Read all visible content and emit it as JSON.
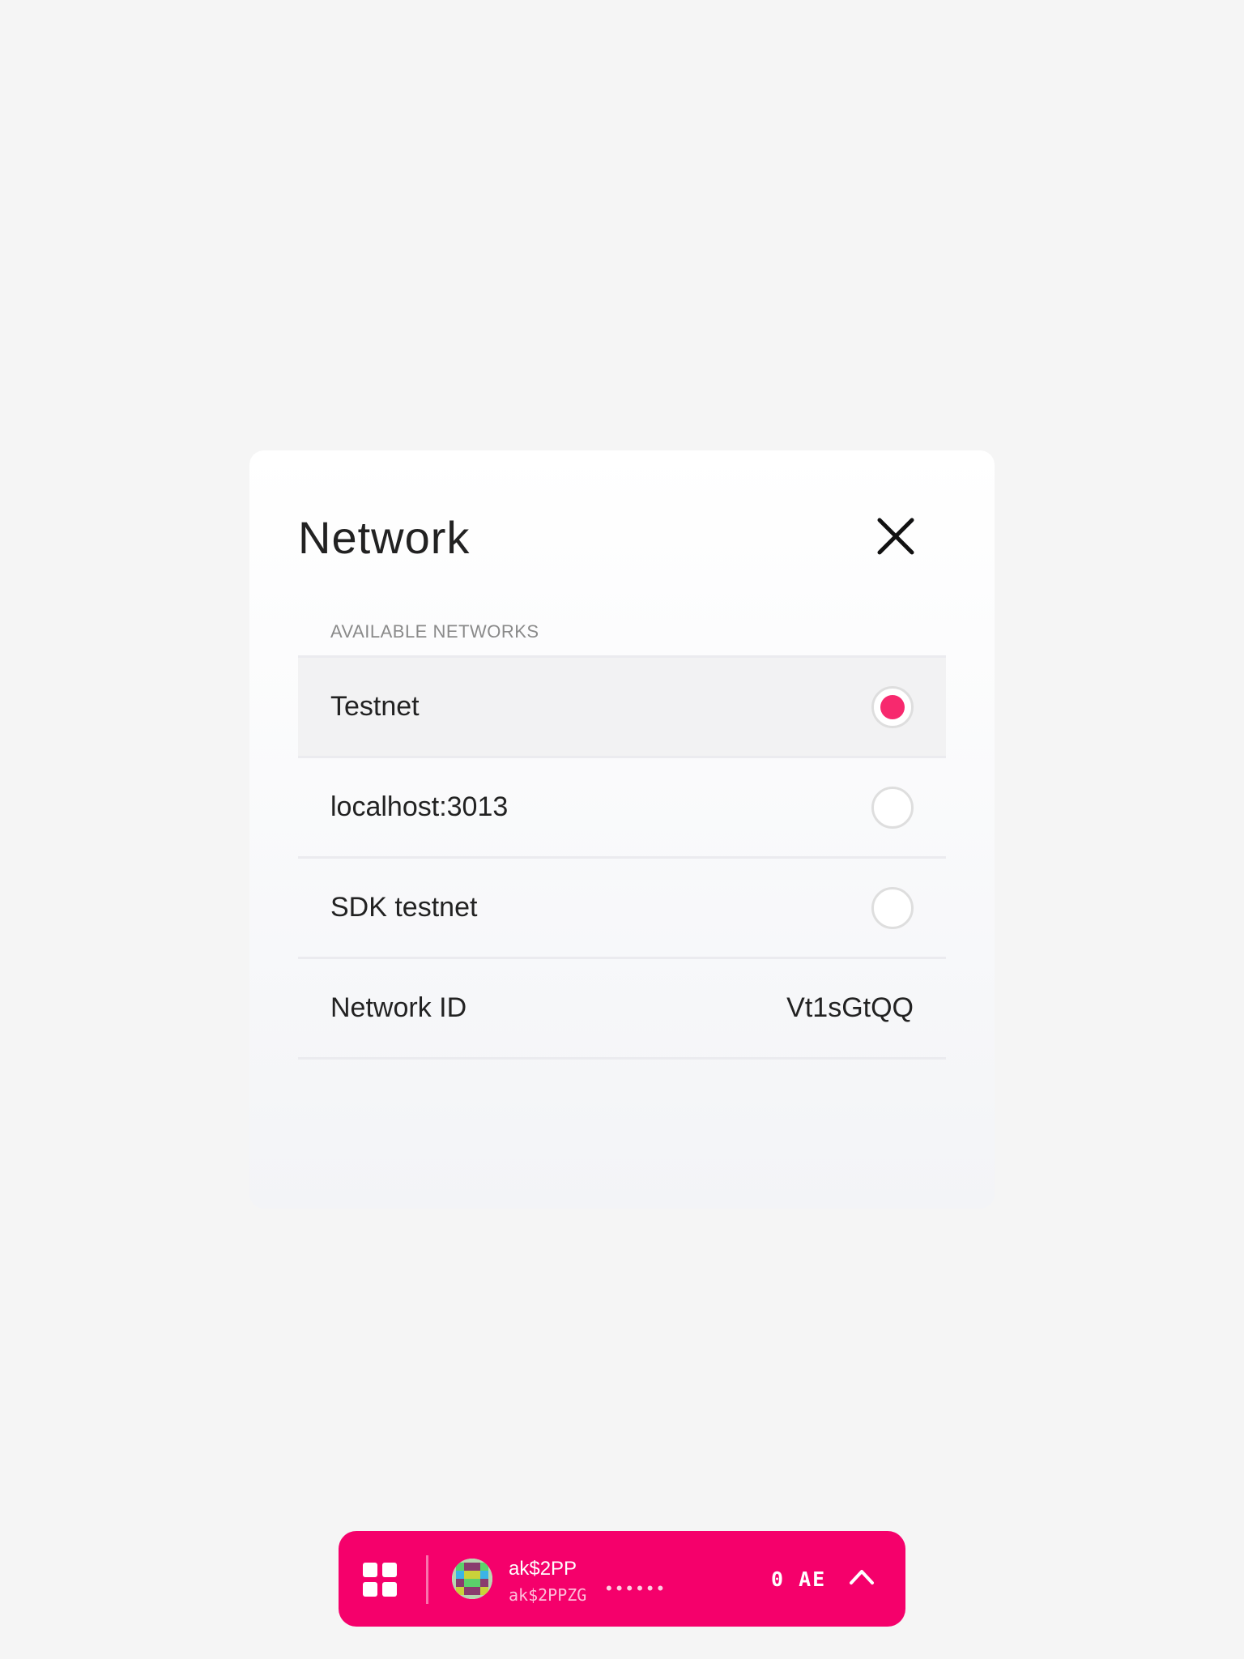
{
  "modal": {
    "title": "Network",
    "section_label": "AVAILABLE NETWORKS",
    "networks": [
      {
        "name": "Testnet",
        "selected": true
      },
      {
        "name": "localhost:3013",
        "selected": false
      },
      {
        "name": "SDK testnet",
        "selected": false
      }
    ],
    "network_id": {
      "label": "Network ID",
      "value": "Vt1sGtQQ"
    }
  },
  "account_bar": {
    "name": "ak$2PP",
    "address": "ak$2PPZG",
    "masked": "••••••",
    "balance": "0 AE"
  },
  "colors": {
    "accent": "#f5006b",
    "radio_selected": "#f7296e",
    "background": "#f5f5f5"
  },
  "icons": {
    "close": "close-icon",
    "apps": "apps-grid-icon",
    "expand": "chevron-up-icon",
    "avatar": "identicon-avatar"
  }
}
